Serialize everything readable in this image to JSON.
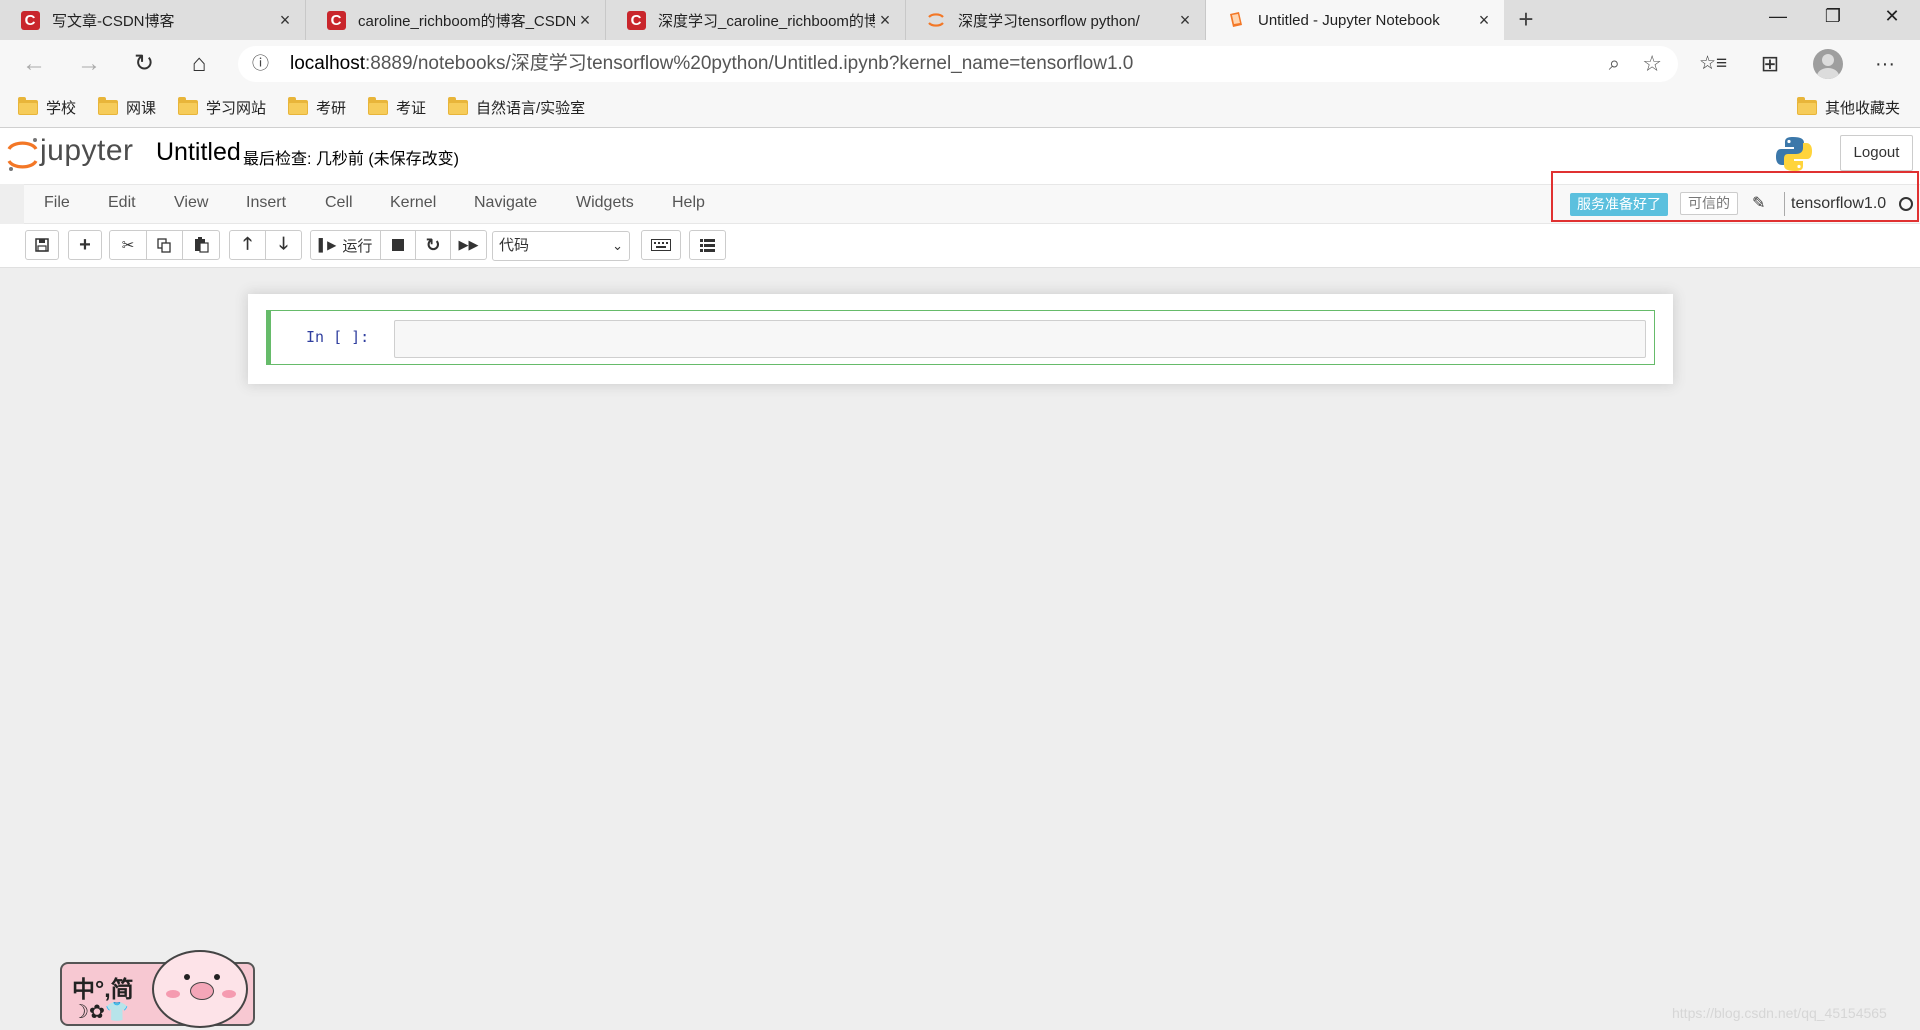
{
  "browser": {
    "tabs": [
      {
        "title": "写文章-CSDN博客",
        "favicon": "csdn-icon"
      },
      {
        "title": "caroline_richboom的博客_CSDN博",
        "favicon": "csdn-icon"
      },
      {
        "title": "深度学习_caroline_richboom的博",
        "favicon": "csdn-icon"
      },
      {
        "title": "深度学习tensorflow python/",
        "favicon": "jupyter-icon"
      },
      {
        "title": "Untitled - Jupyter Notebook",
        "favicon": "notebook-icon",
        "active": true
      }
    ],
    "close_glyph": "×",
    "new_tab_glyph": "+",
    "window": {
      "minimize": "—",
      "restore": "❐",
      "close": "✕"
    },
    "address": {
      "host": "localhost",
      "rest": ":8889/notebooks/深度学习tensorflow%20python/Untitled.ipynb?kernel_name=tensorflow1.0"
    },
    "nav": {
      "back": "←",
      "forward": "→",
      "refresh": "↻",
      "home": "⌂",
      "favorites": "☆≡",
      "collections": "⊞",
      "more": "···"
    },
    "bookmarks": [
      "学校",
      "网课",
      "学习网站",
      "考研",
      "考证",
      "自然语言/实验室"
    ],
    "other_bookmarks": "其他收藏夹"
  },
  "jupyter": {
    "logo_text": "jupyter",
    "notebook_title": "Untitled",
    "checkpoint": "最后检查: 几秒前  (未保存改变)",
    "logout": "Logout",
    "menu": [
      "File",
      "Edit",
      "View",
      "Insert",
      "Cell",
      "Kernel",
      "Navigate",
      "Widgets",
      "Help"
    ],
    "kernel_status": "服务准备好了",
    "trusted": "可信的",
    "kernel_name": "tensorflow1.0",
    "run_label": "运行",
    "cell_type": "代码",
    "cell_prompt": "In  [  ]:"
  },
  "ime": {
    "top": "中°,简",
    "bottom": "☽✿👕"
  },
  "watermark": "https://blog.csdn.net/qq_45154565",
  "colors": {
    "accent_kernel_idle": "#5bc0de",
    "cell_selected": "#66bb6a",
    "highlight_box": "#e03131",
    "csdn_red": "#c9262c"
  }
}
